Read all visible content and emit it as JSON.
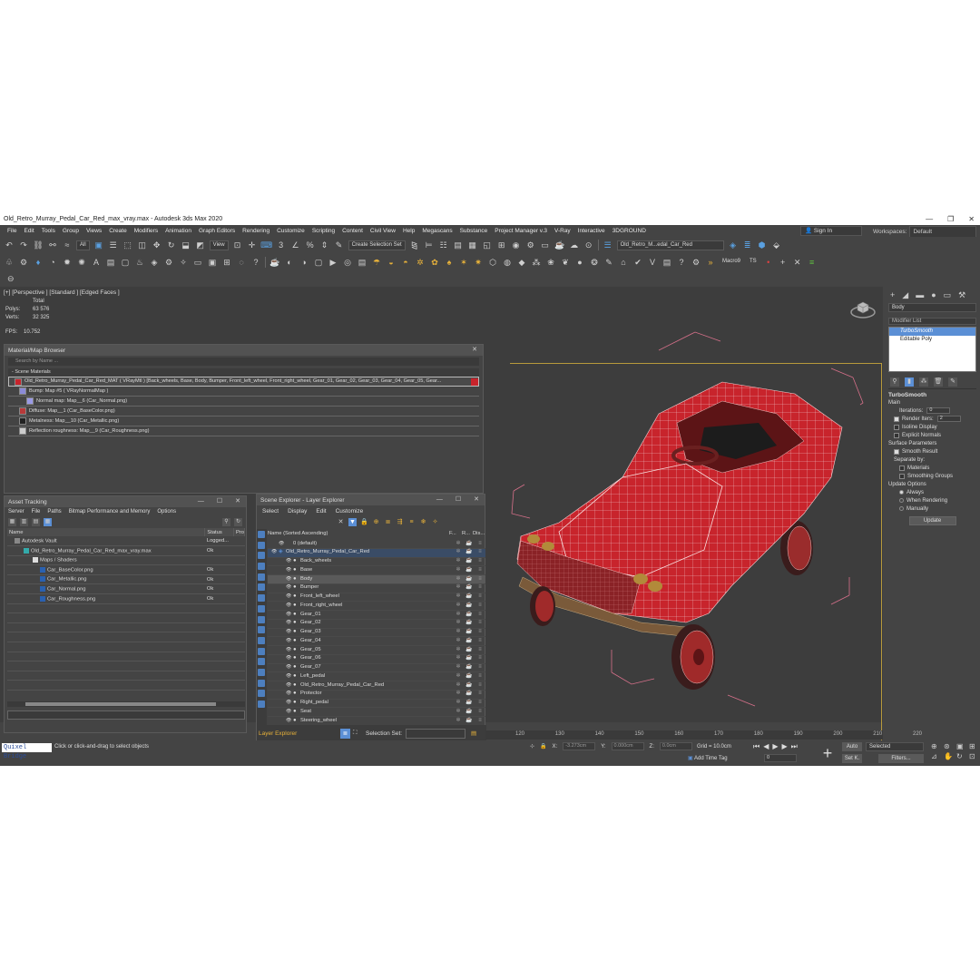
{
  "window": {
    "title": "Old_Retro_Murray_Pedal_Car_Red_max_vray.max - Autodesk 3ds Max 2020"
  },
  "menu": [
    "File",
    "Edit",
    "Tools",
    "Group",
    "Views",
    "Create",
    "Modifiers",
    "Animation",
    "Graph Editors",
    "Rendering",
    "Customize",
    "Scripting",
    "Content",
    "Civil View",
    "Help",
    "Megascans",
    "Substance",
    "Project Manager v.3",
    "V-Ray",
    "Interactive",
    "3DGROUND"
  ],
  "signin": "Sign In",
  "workspace": {
    "label": "Workspaces:",
    "value": "Default"
  },
  "toolbar": {
    "filter": "All",
    "view": "View",
    "selection_set": "Create Selection Set",
    "layer_dd": "Old_Retro_M...edal_Car_Red",
    "macro": "Macro9",
    "ts": "TS"
  },
  "viewport": {
    "label": "[+] [Perspective ] [Standard ] [Edged Faces ]",
    "stats_header": "Total",
    "polys_label": "Polys:",
    "polys": "63 576",
    "verts_label": "Verts:",
    "verts": "32 325",
    "fps_label": "FPS:",
    "fps": "10.752"
  },
  "command_panel": {
    "object_name": "Body",
    "modifier_list": "Modifier List",
    "stack": [
      "TurboSmooth",
      "Editable Poly"
    ],
    "turbosmooth": {
      "title": "TurboSmooth",
      "main": "Main",
      "iterations_label": "Iterations:",
      "iterations": "0",
      "render_iters_label": "Render Iters:",
      "render_iters": "2",
      "isoline": "Isoline Display",
      "explicit": "Explicit Normals",
      "surface_params": "Surface Parameters",
      "smooth_result": "Smooth Result",
      "separate_by": "Separate by:",
      "materials": "Materials",
      "smoothing_groups": "Smoothing Groups",
      "update_options": "Update Options",
      "always": "Always",
      "when_rendering": "When Rendering",
      "manually": "Manually",
      "update": "Update"
    }
  },
  "material_browser": {
    "title": "Material/Map Browser",
    "search": "Search by Name ...",
    "section": "- Scene Materials",
    "rows": [
      "Old_Retro_Murray_Pedal_Car_Red_MAT  ( VRayMtl )  [Back_wheels, Base, Body, Bumper, Front_left_wheel, Front_right_wheel, Gear_01, Gear_02, Gear_03, Gear_04, Gear_05, Gear...",
      "Bump: Map #5  ( VRayNormalMap )",
      "Normal map: Map__6 (Car_Normal.png)",
      "Diffuse: Map__1 (Car_BaseColor.png)",
      "Metalness: Map__10 (Car_Metallic.png)",
      "Reflection roughness: Map__9 (Car_Roughness.png)"
    ]
  },
  "asset_tracking": {
    "title": "Asset Tracking",
    "menu": [
      "Server",
      "File",
      "Paths",
      "Bitmap Performance and Memory",
      "Options"
    ],
    "columns": [
      "Name",
      "Status",
      "Pro"
    ],
    "rows": [
      {
        "name": "Autodesk Vault",
        "status": "Logged..."
      },
      {
        "name": "Old_Retro_Murray_Pedal_Car_Red_max_vray.max",
        "status": "Ok"
      },
      {
        "name": "Maps / Shaders",
        "status": ""
      },
      {
        "name": "Car_BaseColor.png",
        "status": "Ok"
      },
      {
        "name": "Car_Metallic.png",
        "status": "Ok"
      },
      {
        "name": "Car_Normal.png",
        "status": "Ok"
      },
      {
        "name": "Car_Roughness.png",
        "status": "Ok"
      }
    ]
  },
  "scene_explorer": {
    "title": "Scene Explorer - Layer Explorer",
    "menu": [
      "Select",
      "Display",
      "Edit",
      "Customize"
    ],
    "header": {
      "name": "Name (Sorted Ascending)",
      "f": "F...",
      "r": "R...",
      "d": "Dis..."
    },
    "rows": [
      "0 (default)",
      "Old_Retro_Murray_Pedal_Car_Red",
      "Back_wheels",
      "Base",
      "Body",
      "Bumper",
      "Front_left_wheel",
      "Front_right_wheel",
      "Gear_01",
      "Gear_02",
      "Gear_03",
      "Gear_04",
      "Gear_05",
      "Gear_06",
      "Gear_07",
      "Left_pedal",
      "Old_Retro_Murray_Pedal_Car_Red",
      "Protector",
      "Right_pedal",
      "Seat",
      "Steering_wheel"
    ],
    "footer_label": "Layer Explorer",
    "selection_set": "Selection Set:"
  },
  "timeline": {
    "ticks": [
      "120",
      "130",
      "140",
      "150",
      "160",
      "170",
      "180",
      "190",
      "200",
      "210",
      "220"
    ]
  },
  "status": {
    "quixel": "Quixel Bridge",
    "prompt": "Click or click-and-drag to select objects",
    "x_label": "X:",
    "x": "-3.273cm",
    "y_label": "Y:",
    "y": "0.000cm",
    "z_label": "Z:",
    "z": "0.0cm",
    "grid": "Grid = 10.0cm",
    "add_time_tag": "Add Time Tag",
    "frame": "0",
    "auto": "Auto",
    "setk": "Set K.",
    "selected": "Selected",
    "filters": "Filters..."
  },
  "colors": {
    "car_red": "#c8242c",
    "highlight": "#5b8fd5",
    "bg": "#444444"
  }
}
